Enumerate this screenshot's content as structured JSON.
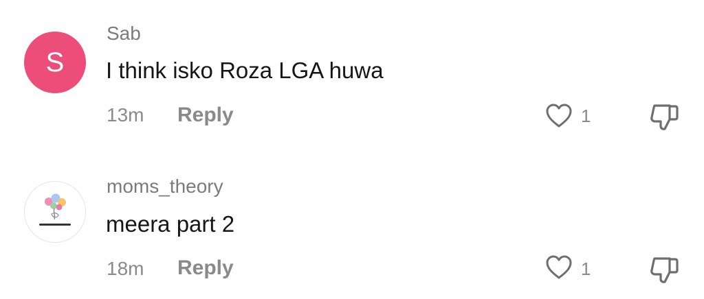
{
  "comments": [
    {
      "username": "Sab",
      "avatar": {
        "type": "letter",
        "letter": "S",
        "color": "#ec4e79"
      },
      "text": "I think isko Roza LGA huwa",
      "time": "13m",
      "reply_label": "Reply",
      "like_icon": "heart-outline-icon",
      "like_count": "1",
      "dislike_icon": "thumbs-down-icon"
    },
    {
      "username": "moms_theory",
      "avatar": {
        "type": "image",
        "logo_text": "Moms_theory",
        "colors": [
          "#f08fb0",
          "#a9c7f0",
          "#f7c46c",
          "#9ad1a3"
        ]
      },
      "text": "meera part 2",
      "time": "18m",
      "reply_label": "Reply",
      "like_icon": "heart-outline-icon",
      "like_count": "1",
      "dislike_icon": "thumbs-down-icon"
    }
  ],
  "colors": {
    "secondary_text": "#8a8a8a",
    "primary_text": "#161616",
    "icon_stroke": "#6e6e6e"
  }
}
